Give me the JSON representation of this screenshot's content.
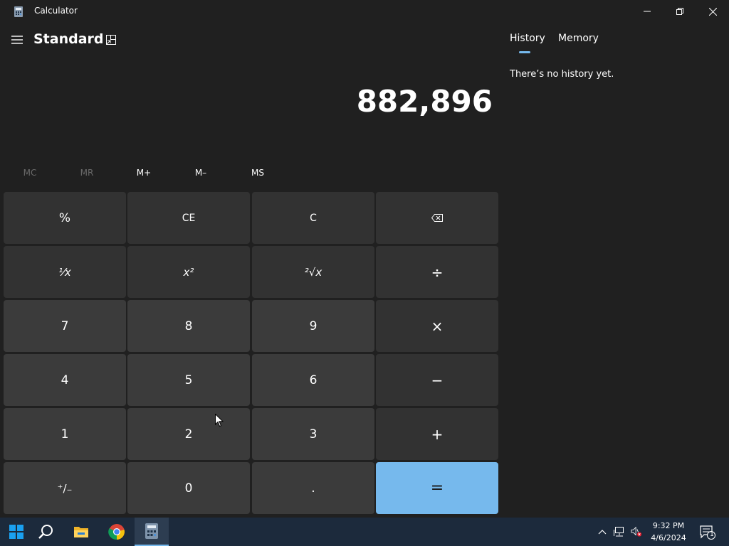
{
  "window": {
    "title": "Calculator",
    "app_icon": "calculator-icon"
  },
  "header": {
    "mode": "Standard",
    "menu_icon": "hamburger-icon",
    "keep_on_top_icon": "keep-on-top-icon"
  },
  "display": {
    "value": "882,896"
  },
  "memory": {
    "mc": "MC",
    "mr": "MR",
    "mplus": "M+",
    "mminus": "M–",
    "ms": "MS"
  },
  "keys": {
    "percent": "%",
    "ce": "CE",
    "c": "C",
    "backspace": "⌫",
    "reciprocal": "¹⁄x",
    "square": "x²",
    "sqrt": "²√x",
    "divide": "÷",
    "seven": "7",
    "eight": "8",
    "nine": "9",
    "multiply": "×",
    "four": "4",
    "five": "5",
    "six": "6",
    "minus": "−",
    "one": "1",
    "two": "2",
    "three": "3",
    "plus": "+",
    "negate": "⁺/₋",
    "zero": "0",
    "decimal": ".",
    "equals": "="
  },
  "side_panel": {
    "tabs": [
      "History",
      "Memory"
    ],
    "active_tab": "History",
    "empty_message": "There’s no history yet."
  },
  "taskbar": {
    "time": "9:32 PM",
    "date": "4/6/2024",
    "notification_count": "1"
  },
  "colors": {
    "accent": "#76b9ed",
    "background": "#202020",
    "key_number": "#3b3b3b",
    "key_operator": "#323232"
  }
}
